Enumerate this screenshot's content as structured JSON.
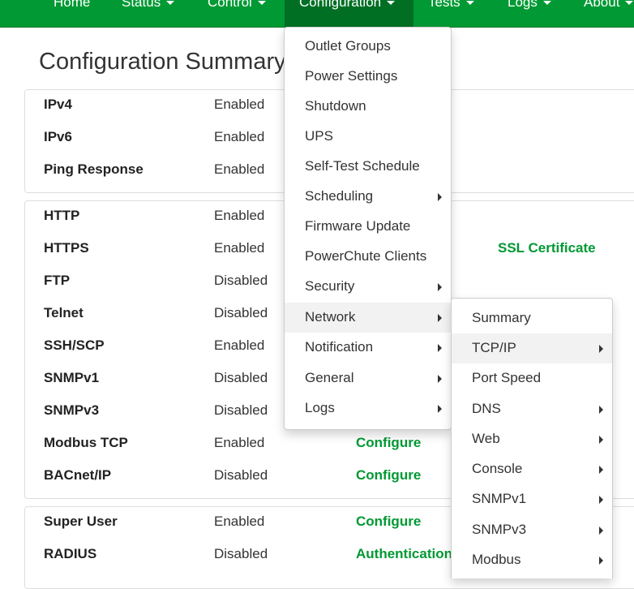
{
  "nav": {
    "items": [
      {
        "label": "Home",
        "caret": false,
        "active": false
      },
      {
        "label": "Status",
        "caret": true,
        "active": false
      },
      {
        "label": "Control",
        "caret": true,
        "active": false
      },
      {
        "label": "Configuration",
        "caret": true,
        "active": true
      },
      {
        "label": "Tests",
        "caret": true,
        "active": false
      },
      {
        "label": "Logs",
        "caret": true,
        "active": false
      },
      {
        "label": "About",
        "caret": true,
        "active": false
      }
    ]
  },
  "page": {
    "title": "Configuration Summary"
  },
  "panels": [
    {
      "rows": [
        {
          "name": "IPv4",
          "status": "Enabled",
          "link": ""
        },
        {
          "name": "IPv6",
          "status": "Enabled",
          "link": ""
        },
        {
          "name": "Ping Response",
          "status": "Enabled",
          "link": ""
        }
      ]
    },
    {
      "rows": [
        {
          "name": "HTTP",
          "status": "Enabled",
          "link": ""
        },
        {
          "name": "HTTPS",
          "status": "Enabled",
          "link": "SSL Certificate"
        },
        {
          "name": "FTP",
          "status": "Disabled",
          "link": ""
        },
        {
          "name": "Telnet",
          "status": "Disabled",
          "link": ""
        },
        {
          "name": "SSH/SCP",
          "status": "Enabled",
          "link": ""
        },
        {
          "name": "SNMPv1",
          "status": "Disabled",
          "link": ""
        },
        {
          "name": "SNMPv3",
          "status": "Disabled",
          "link": ""
        },
        {
          "name": "Modbus TCP",
          "status": "Enabled",
          "link": "Configure"
        },
        {
          "name": "BACnet/IP",
          "status": "Disabled",
          "link": "Configure"
        }
      ]
    },
    {
      "rows": [
        {
          "name": "Super User",
          "status": "Enabled",
          "link": "Configure"
        },
        {
          "name": "RADIUS",
          "status": "Disabled",
          "link": "Authentication"
        }
      ]
    }
  ],
  "config_menu": {
    "items": [
      {
        "label": "Outlet Groups",
        "submenu": false,
        "highlighted": false
      },
      {
        "label": "Power Settings",
        "submenu": false,
        "highlighted": false
      },
      {
        "label": "Shutdown",
        "submenu": false,
        "highlighted": false
      },
      {
        "label": "UPS",
        "submenu": false,
        "highlighted": false
      },
      {
        "label": "Self-Test Schedule",
        "submenu": false,
        "highlighted": false
      },
      {
        "label": "Scheduling",
        "submenu": true,
        "highlighted": false
      },
      {
        "label": "Firmware Update",
        "submenu": false,
        "highlighted": false
      },
      {
        "label": "PowerChute Clients",
        "submenu": false,
        "highlighted": false
      },
      {
        "label": "Security",
        "submenu": true,
        "highlighted": false
      },
      {
        "label": "Network",
        "submenu": true,
        "highlighted": true
      },
      {
        "label": "Notification",
        "submenu": true,
        "highlighted": false
      },
      {
        "label": "General",
        "submenu": true,
        "highlighted": false
      },
      {
        "label": "Logs",
        "submenu": true,
        "highlighted": false
      }
    ]
  },
  "network_menu": {
    "items": [
      {
        "label": "Summary",
        "submenu": false,
        "highlighted": false
      },
      {
        "label": "TCP/IP",
        "submenu": true,
        "highlighted": true
      },
      {
        "label": "Port Speed",
        "submenu": false,
        "highlighted": false
      },
      {
        "label": "DNS",
        "submenu": true,
        "highlighted": false
      },
      {
        "label": "Web",
        "submenu": true,
        "highlighted": false
      },
      {
        "label": "Console",
        "submenu": true,
        "highlighted": false
      },
      {
        "label": "SNMPv1",
        "submenu": true,
        "highlighted": false
      },
      {
        "label": "SNMPv3",
        "submenu": true,
        "highlighted": false
      },
      {
        "label": "Modbus",
        "submenu": true,
        "highlighted": false
      }
    ]
  },
  "colors": {
    "brand": "#009933",
    "brand_active": "#006f24",
    "link": "#009933",
    "highlight": "#f2f2f2"
  }
}
